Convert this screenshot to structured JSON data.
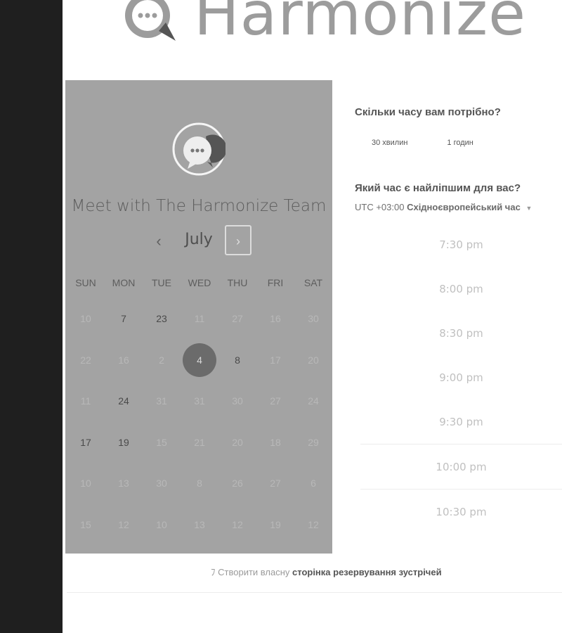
{
  "brand": {
    "name": "Harmonize",
    "logo_icon": "chat-bubble-icon"
  },
  "calendar": {
    "title": "Meet with The Harmonize Team",
    "month": "July",
    "prev_icon": "‹",
    "next_icon": "›",
    "weekdays": [
      "SUN",
      "MON",
      "TUE",
      "WED",
      "THU",
      "FRI",
      "SAT"
    ],
    "weeks": [
      [
        {
          "d": "10",
          "a": false
        },
        {
          "d": "7",
          "a": true
        },
        {
          "d": "23",
          "a": true
        },
        {
          "d": "11",
          "a": false
        },
        {
          "d": "27",
          "a": false
        },
        {
          "d": "16",
          "a": false
        },
        {
          "d": "30",
          "a": false
        }
      ],
      [
        {
          "d": "22",
          "a": false
        },
        {
          "d": "16",
          "a": false
        },
        {
          "d": "2",
          "a": false
        },
        {
          "d": "4",
          "a": true,
          "selected": true
        },
        {
          "d": "8",
          "a": true
        },
        {
          "d": "17",
          "a": false
        },
        {
          "d": "20",
          "a": false
        }
      ],
      [
        {
          "d": "11",
          "a": false
        },
        {
          "d": "24",
          "a": true
        },
        {
          "d": "31",
          "a": false
        },
        {
          "d": "31",
          "a": false
        },
        {
          "d": "30",
          "a": false
        },
        {
          "d": "27",
          "a": false
        },
        {
          "d": "24",
          "a": false
        }
      ],
      [
        {
          "d": "17",
          "a": true
        },
        {
          "d": "19",
          "a": true
        },
        {
          "d": "15",
          "a": false
        },
        {
          "d": "21",
          "a": false
        },
        {
          "d": "20",
          "a": false
        },
        {
          "d": "18",
          "a": false
        },
        {
          "d": "29",
          "a": false
        }
      ],
      [
        {
          "d": "10",
          "a": false
        },
        {
          "d": "13",
          "a": false
        },
        {
          "d": "30",
          "a": false
        },
        {
          "d": "8",
          "a": false
        },
        {
          "d": "26",
          "a": false
        },
        {
          "d": "27",
          "a": false
        },
        {
          "d": "6",
          "a": false
        }
      ],
      [
        {
          "d": "15",
          "a": false
        },
        {
          "d": "12",
          "a": false
        },
        {
          "d": "10",
          "a": false
        },
        {
          "d": "13",
          "a": false
        },
        {
          "d": "12",
          "a": false
        },
        {
          "d": "19",
          "a": false
        },
        {
          "d": "12",
          "a": false
        }
      ]
    ]
  },
  "duration": {
    "question": "Скільки часу вам потрібно?",
    "options": [
      "30 хвилин",
      "1 годин"
    ]
  },
  "time": {
    "question": "Який час є найліпшим для вас?",
    "tz_offset": "UTC +03:00",
    "tz_name": "Східноєвропейський час",
    "slots": [
      "7:30 pm",
      "8:00 pm",
      "8:30 pm",
      "9:00 pm",
      "9:30 pm",
      "10:00 pm",
      "10:30 pm"
    ]
  },
  "footer": {
    "prefix": "Створити власну",
    "link": "сторінка резервування зустрічей",
    "icon": "sprocket-icon"
  }
}
